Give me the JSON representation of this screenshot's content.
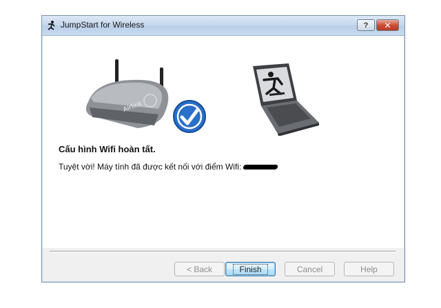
{
  "window": {
    "title": "JumpStart for Wireless",
    "help_symbol": "?",
    "close_symbol": "✕"
  },
  "content": {
    "heading": "Cấu hình Wifi hoàn tất.",
    "message": "Tuyệt vời! Máy tính đã được kết nối với điểm Wifi:",
    "router_label": "Airlink"
  },
  "buttons": {
    "back": "< Back",
    "finish": "Finish",
    "cancel": "Cancel",
    "help": "Help"
  },
  "icons": {
    "app": "jumpstart-runner-icon",
    "router": "wireless-router-icon",
    "success": "checkmark-icon",
    "laptop": "laptop-icon"
  },
  "colors": {
    "checkmark_blue": "#2a6fc9",
    "title_bar": "#c7d9ee",
    "close_red": "#c9503a"
  }
}
